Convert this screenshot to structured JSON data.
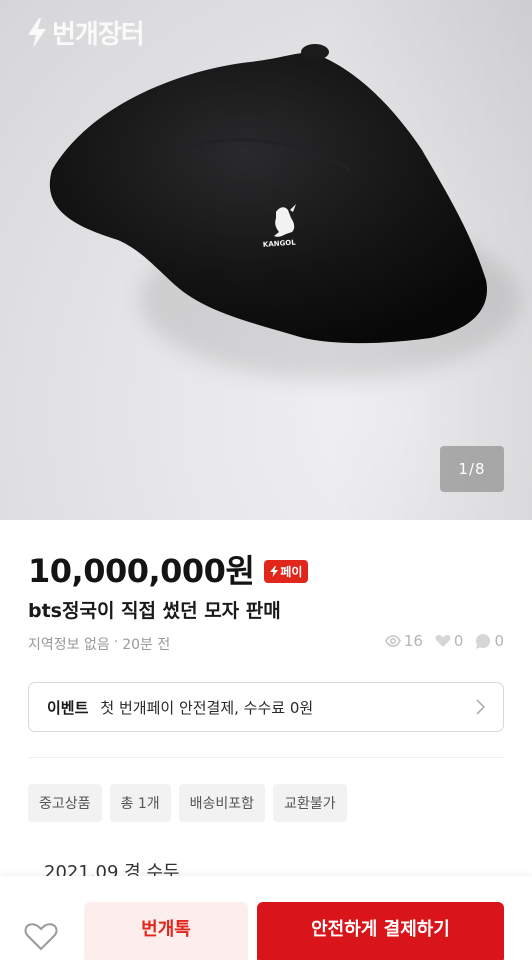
{
  "app": {
    "logo_text": "번개장터",
    "accent_color": "#e1261c"
  },
  "hero": {
    "image_description": "black bucket hat",
    "hat_logo_text": "KANGOL",
    "counter": "1/8"
  },
  "product": {
    "price": "10,000,000원",
    "pay_badge": "페이",
    "title": "bts정국이 직접 썼던 모자 판매",
    "location": "지역정보 없음",
    "separator": "·",
    "time_ago": "20분 전",
    "stats": {
      "views": "16",
      "likes": "0",
      "chats": "0",
      "view_icon": "eye-icon",
      "like_icon": "heart-icon",
      "chat_icon": "chat-bubble-icon"
    }
  },
  "event": {
    "tag": "이벤트",
    "text": "첫 번개페이 안전결제, 수수료 0원"
  },
  "tags": [
    "중고상품",
    "총 1개",
    "배송비포함",
    "교환불가"
  ],
  "description_peek": "2021.09 경 수두",
  "bottom_bar": {
    "chat_button": "번개톡",
    "pay_button": "안전하게 결제하기",
    "chat_button_bg": "#fdeeee",
    "pay_button_bg": "#d9141a"
  }
}
